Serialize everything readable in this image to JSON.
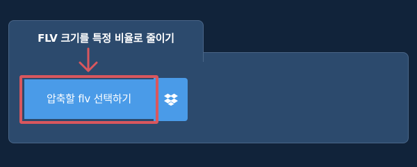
{
  "panel": {
    "title": "FLV 크기를 특정 비율로 줄이기"
  },
  "upload": {
    "button_label": "압축할 flv 선택하기",
    "dropbox_icon": "dropbox-icon"
  },
  "colors": {
    "page_background": "#11233a",
    "panel_background": "#2c4a6d",
    "button_background": "#4a9be8",
    "highlight": "#d9575e"
  }
}
